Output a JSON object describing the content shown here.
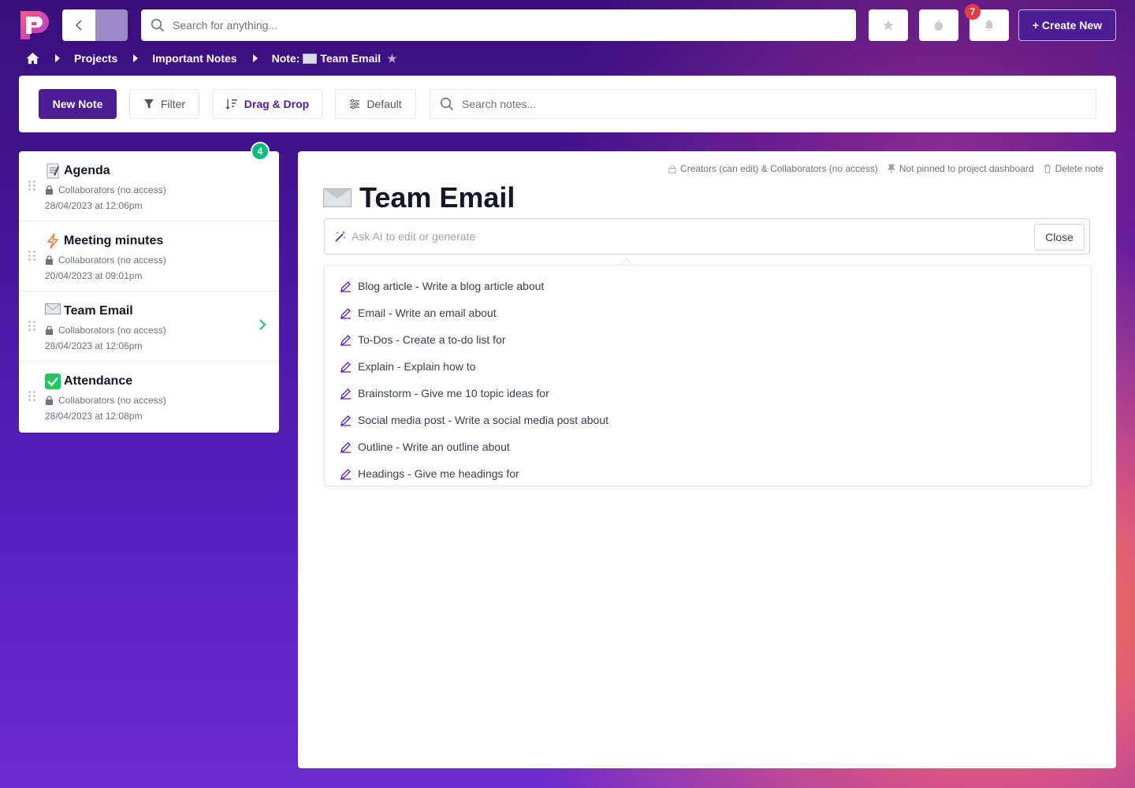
{
  "topbar": {
    "search_placeholder": "Search for anything...",
    "notification_count": "7",
    "create_label": "+ Create New"
  },
  "breadcrumb": {
    "items": [
      "Projects",
      "Important Notes"
    ],
    "current_prefix": "Note:",
    "current_title": "Team Email"
  },
  "toolbar": {
    "new_note": "New Note",
    "filter": "Filter",
    "drag_drop": "Drag & Drop",
    "default": "Default",
    "search_placeholder": "Search notes..."
  },
  "notes": {
    "count": "4",
    "items": [
      {
        "title": "Agenda",
        "icon": "memo",
        "access": "Collaborators (no access)",
        "date": "28/04/2023 at 12:06pm"
      },
      {
        "title": "Meeting minutes",
        "icon": "lightning",
        "access": "Collaborators (no access)",
        "date": "20/04/2023 at 09:01pm"
      },
      {
        "title": "Team Email",
        "icon": "envelope",
        "access": "Collaborators (no access)",
        "date": "28/04/2023 at 12:06pm"
      },
      {
        "title": "Attendance",
        "icon": "check-box",
        "access": "Collaborators (no access)",
        "date": "28/04/2023 at 12:08pm"
      }
    ]
  },
  "main": {
    "access": "Creators (can edit) & Collaborators (no access)",
    "pin": "Not pinned to project dashboard",
    "delete": "Delete note",
    "title": "Team Email",
    "ai_placeholder": "Ask AI to edit or generate",
    "close": "Close",
    "ai_options": [
      "Blog article - Write a blog article about",
      "Email - Write an email about",
      "To-Dos - Create a to-do list for",
      "Explain - Explain how to",
      "Brainstorm - Give me 10 topic ideas for",
      "Social media post - Write a social media post about",
      "Outline - Write an outline about",
      "Headings - Give me headings for"
    ]
  },
  "colors": {
    "brand": "#4c1d95",
    "accent_green": "#10b981",
    "badge_red": "#e53945"
  }
}
